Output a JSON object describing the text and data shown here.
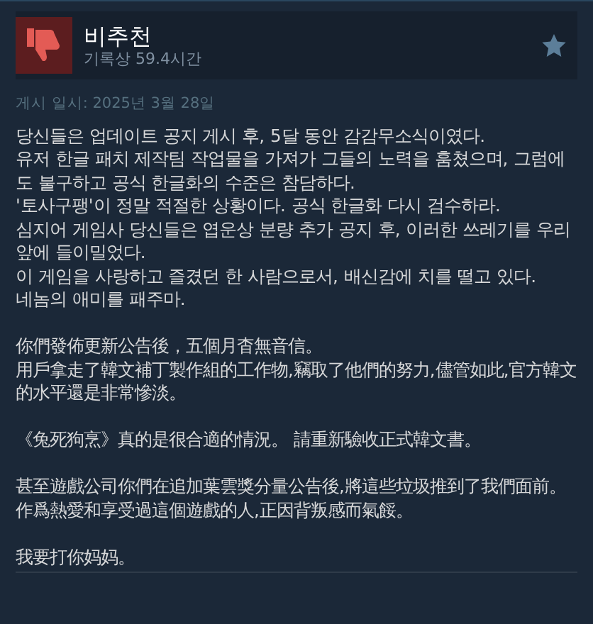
{
  "review": {
    "verdict": "비추천",
    "recommended": false,
    "hours": "기록상 59.4시간",
    "posted": "게시 일시: 2025년 3월 28일",
    "sections": [
      [
        "당신들은 업데이트 공지 게시 후, 5달 동안 감감무소식이였다.",
        "유저 한글 패치 제작팀 작업물을 가져가 그들의 노력을 훔쳤으며, 그럼에도 불구하고 공식 한글화의 수준은 참담하다.",
        "'토사구팽'이 정말 적절한 상황이다. 공식 한글화 다시 검수하라.",
        "심지어 게임사 당신들은 엽운상 분량 추가 공지 후, 이러한 쓰레기를 우리 앞에 들이밀었다.",
        "이 게임을 사랑하고 즐겼던 한 사람으로서, 배신감에 치를 떨고 있다.",
        "네놈의 애미를 패주마."
      ],
      [
        "你們發佈更新公告後，五個月杳無音信。",
        "用戶拿走了韓文補丁製作組的工作物,竊取了他們的努力,儘管如此,官方韓文的水平還是非常慘淡。"
      ],
      [
        "《兔死狗烹》真的是很合適的情況。 請重新驗收正式韓文書。"
      ],
      [
        "甚至遊戲公司你們在追加葉雲獎分量公告後,將這些垃圾推到了我們面前。",
        "作爲熱愛和享受過這個遊戲的人,正因背叛感而氣餒。"
      ],
      [
        "我要打你妈妈。"
      ]
    ]
  }
}
